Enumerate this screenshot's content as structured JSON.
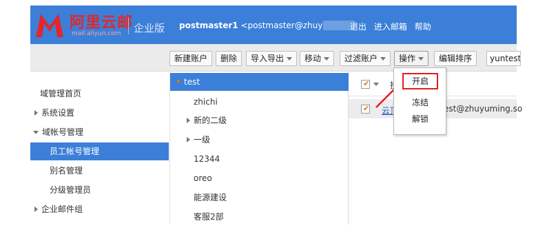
{
  "header": {
    "logo_text": "阿里云邮",
    "logo_url": "mail.aliyun.com",
    "edition": "企业版",
    "user_name": "postmaster1",
    "user_email": "<postmaster@zhuy",
    "links": [
      "退出",
      "进入邮箱",
      "帮助"
    ],
    "colors": {
      "header_bg": "#3c7fd9",
      "logo_red": "#e0282b"
    }
  },
  "toolbar": {
    "buttons": [
      {
        "label": "新建账户",
        "dropdown": false
      },
      {
        "label": "删除",
        "dropdown": false
      },
      {
        "label": "导入导出",
        "dropdown": true
      },
      {
        "label": "移动",
        "dropdown": true
      },
      {
        "label": "过滤账户",
        "dropdown": true
      },
      {
        "label": "操作",
        "dropdown": true
      },
      {
        "label": "编辑排序",
        "dropdown": false
      }
    ],
    "search_value": "yuntest"
  },
  "sidebar": {
    "items": [
      {
        "label": "域管理首页",
        "icon": ""
      },
      {
        "label": "系统设置",
        "icon": "chevron-right-icon"
      },
      {
        "label": "域帐号管理",
        "icon": "chevron-down-icon"
      },
      {
        "label": "员工帐号管理",
        "icon": "",
        "active": true
      },
      {
        "label": "别名管理",
        "icon": ""
      },
      {
        "label": "分级管理员",
        "icon": ""
      },
      {
        "label": "企业邮件组",
        "icon": "chevron-right-icon"
      }
    ]
  },
  "tree": {
    "items": [
      {
        "label": "test",
        "active": true
      },
      {
        "label": "zhichi"
      },
      {
        "label": "新的二级",
        "expandable": true
      },
      {
        "label": "一级",
        "expandable": true
      },
      {
        "label": "12344"
      },
      {
        "label": "oreo"
      },
      {
        "label": "能源建设"
      },
      {
        "label": "客服2部"
      }
    ]
  },
  "list": {
    "header_partial": "投",
    "row": {
      "name_partial": "云顶",
      "email_partial": "est@zhuyuming.so"
    }
  },
  "menu": {
    "items": [
      "开启",
      "冻结",
      "解锁"
    ],
    "highlight_color": "#e31b1b"
  }
}
